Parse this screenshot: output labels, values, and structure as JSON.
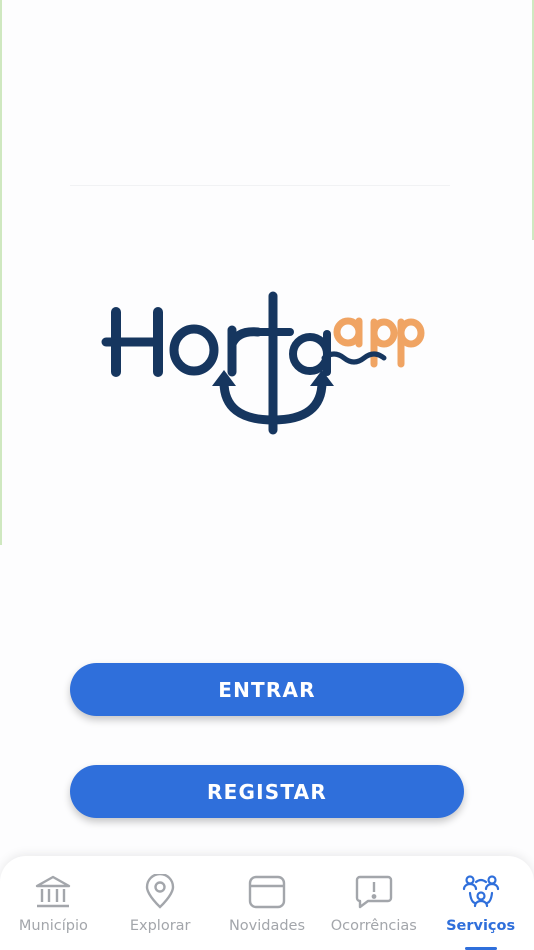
{
  "app": {
    "logo_text": "Horta",
    "logo_suffix": "app"
  },
  "colors": {
    "primary": "#2f6fdb",
    "logo_navy": "#16365f",
    "logo_orange": "#f0a463",
    "tab_inactive": "#a3a6ab"
  },
  "actions": {
    "login_label": "ENTRAR",
    "register_label": "REGISTAR"
  },
  "tabbar": {
    "items": [
      {
        "label": "Município",
        "icon": "bank-icon",
        "active": false
      },
      {
        "label": "Explorar",
        "icon": "map-pin-icon",
        "active": false
      },
      {
        "label": "Novidades",
        "icon": "news-card-icon",
        "active": false
      },
      {
        "label": "Ocorrências",
        "icon": "alert-chat-icon",
        "active": false
      },
      {
        "label": "Serviços",
        "icon": "people-network-icon",
        "active": true
      }
    ]
  }
}
